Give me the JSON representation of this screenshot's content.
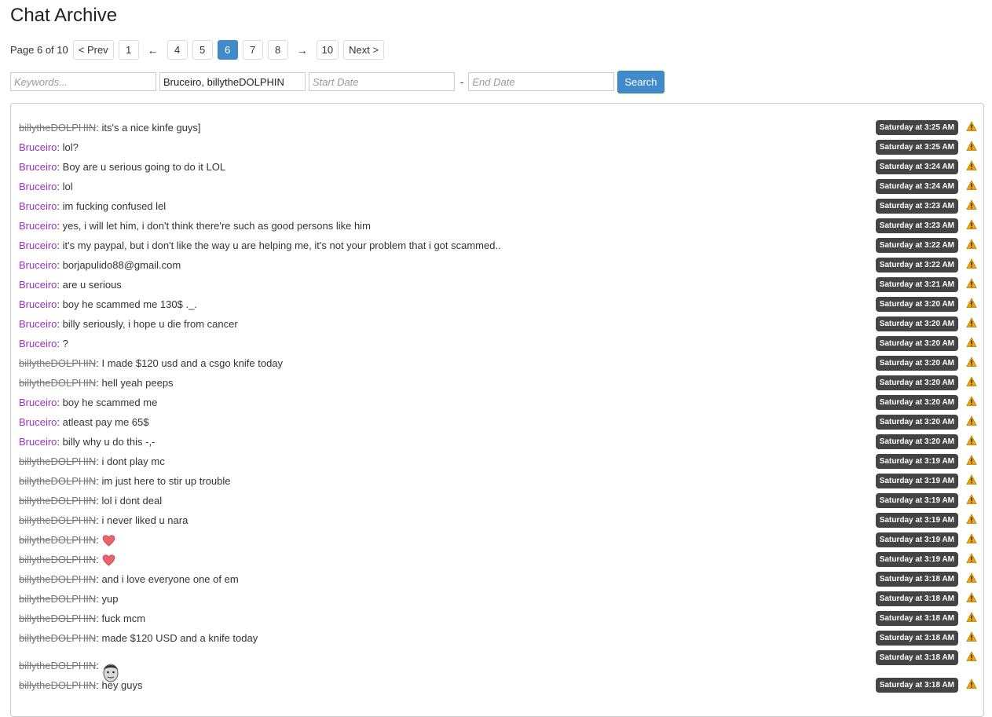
{
  "page": {
    "title": "Chat Archive"
  },
  "pagination": {
    "info": "Page 6 of 10",
    "prev": "< Prev",
    "next": "Next >",
    "left_arrow": "←",
    "right_arrow": "→",
    "first_page": "1",
    "last_page": "10",
    "middle_pages": [
      "4",
      "5",
      "6",
      "7",
      "8"
    ],
    "current_page": "6"
  },
  "filters": {
    "keywords_placeholder": "Keywords...",
    "users_value": "Bruceiro, billytheDOLPHIN",
    "start_placeholder": "Start Date",
    "end_placeholder": "End Date",
    "date_separator": "-",
    "search_label": "Search"
  },
  "colors": {
    "accent": "#428bca",
    "username": "#9b2fc7",
    "struck_username": "#777777",
    "timestamp_bg": "#444444",
    "warning": "#f0a30a"
  },
  "messages": [
    {
      "user": "billytheDOLPHIN",
      "struck": true,
      "text": ": its's a nice kinfe guys]",
      "time": "Saturday at 3:25 AM"
    },
    {
      "user": "Bruceiro",
      "struck": false,
      "text": ": lol?",
      "time": "Saturday at 3:25 AM"
    },
    {
      "user": "Bruceiro",
      "struck": false,
      "text": ": Boy are u serious going to do it LOL",
      "time": "Saturday at 3:24 AM"
    },
    {
      "user": "Bruceiro",
      "struck": false,
      "text": ": lol",
      "time": "Saturday at 3:24 AM"
    },
    {
      "user": "Bruceiro",
      "struck": false,
      "text": ": im fucking confused lel",
      "time": "Saturday at 3:23 AM"
    },
    {
      "user": "Bruceiro",
      "struck": false,
      "text": ": yes, i will let him, i don't think there're such as good persons like him",
      "time": "Saturday at 3:23 AM"
    },
    {
      "user": "Bruceiro",
      "struck": false,
      "text": ": it's my paypal, but i don't like the way u are helping me, it's not your problem that i got scammed..",
      "time": "Saturday at 3:22 AM"
    },
    {
      "user": "Bruceiro",
      "struck": false,
      "text": ": borjapulido88@gmail.com",
      "time": "Saturday at 3:22 AM"
    },
    {
      "user": "Bruceiro",
      "struck": false,
      "text": ": are u serious",
      "time": "Saturday at 3:21 AM"
    },
    {
      "user": "Bruceiro",
      "struck": false,
      "text": ": boy he scammed me 130$ ._.",
      "time": "Saturday at 3:20 AM"
    },
    {
      "user": "Bruceiro",
      "struck": false,
      "text": ": billy seriously, i hope u die from cancer",
      "time": "Saturday at 3:20 AM"
    },
    {
      "user": "Bruceiro",
      "struck": false,
      "text": ": ?",
      "time": "Saturday at 3:20 AM"
    },
    {
      "user": "billytheDOLPHIN",
      "struck": true,
      "text": ": I made $120 usd and a csgo knife today",
      "time": "Saturday at 3:20 AM"
    },
    {
      "user": "billytheDOLPHIN",
      "struck": true,
      "text": ": hell yeah peeps",
      "time": "Saturday at 3:20 AM"
    },
    {
      "user": "Bruceiro",
      "struck": false,
      "text": ": boy he scammed me",
      "time": "Saturday at 3:20 AM"
    },
    {
      "user": "Bruceiro",
      "struck": false,
      "text": ": atleast pay me 65$",
      "time": "Saturday at 3:20 AM"
    },
    {
      "user": "Bruceiro",
      "struck": false,
      "text": ": billy why u do this -,-",
      "time": "Saturday at 3:20 AM"
    },
    {
      "user": "billytheDOLPHIN",
      "struck": true,
      "text": ": i dont play mc",
      "time": "Saturday at 3:19 AM"
    },
    {
      "user": "billytheDOLPHIN",
      "struck": true,
      "text": ": im just here to stir up trouble",
      "time": "Saturday at 3:19 AM"
    },
    {
      "user": "billytheDOLPHIN",
      "struck": true,
      "text": ": lol i dont deal",
      "time": "Saturday at 3:19 AM"
    },
    {
      "user": "billytheDOLPHIN",
      "struck": true,
      "text": ": i never liked u nara",
      "time": "Saturday at 3:19 AM"
    },
    {
      "user": "billytheDOLPHIN",
      "struck": true,
      "text": ":",
      "emoji": "heart",
      "time": "Saturday at 3:19 AM"
    },
    {
      "user": "billytheDOLPHIN",
      "struck": true,
      "text": ":",
      "emoji": "heart",
      "time": "Saturday at 3:19 AM"
    },
    {
      "user": "billytheDOLPHIN",
      "struck": true,
      "text": ": and i love everyone one of em",
      "time": "Saturday at 3:18 AM"
    },
    {
      "user": "billytheDOLPHIN",
      "struck": true,
      "text": ": yup",
      "time": "Saturday at 3:18 AM"
    },
    {
      "user": "billytheDOLPHIN",
      "struck": true,
      "text": ": fuck mcm",
      "time": "Saturday at 3:18 AM"
    },
    {
      "user": "billytheDOLPHIN",
      "struck": true,
      "text": ": made $120 USD and a knife today",
      "time": "Saturday at 3:18 AM"
    },
    {
      "user": "billytheDOLPHIN",
      "struck": true,
      "text": ":",
      "emoji": "face",
      "time": "Saturday at 3:18 AM"
    },
    {
      "user": "billytheDOLPHIN",
      "struck": true,
      "text": ": hey guys",
      "time": "Saturday at 3:18 AM"
    }
  ]
}
